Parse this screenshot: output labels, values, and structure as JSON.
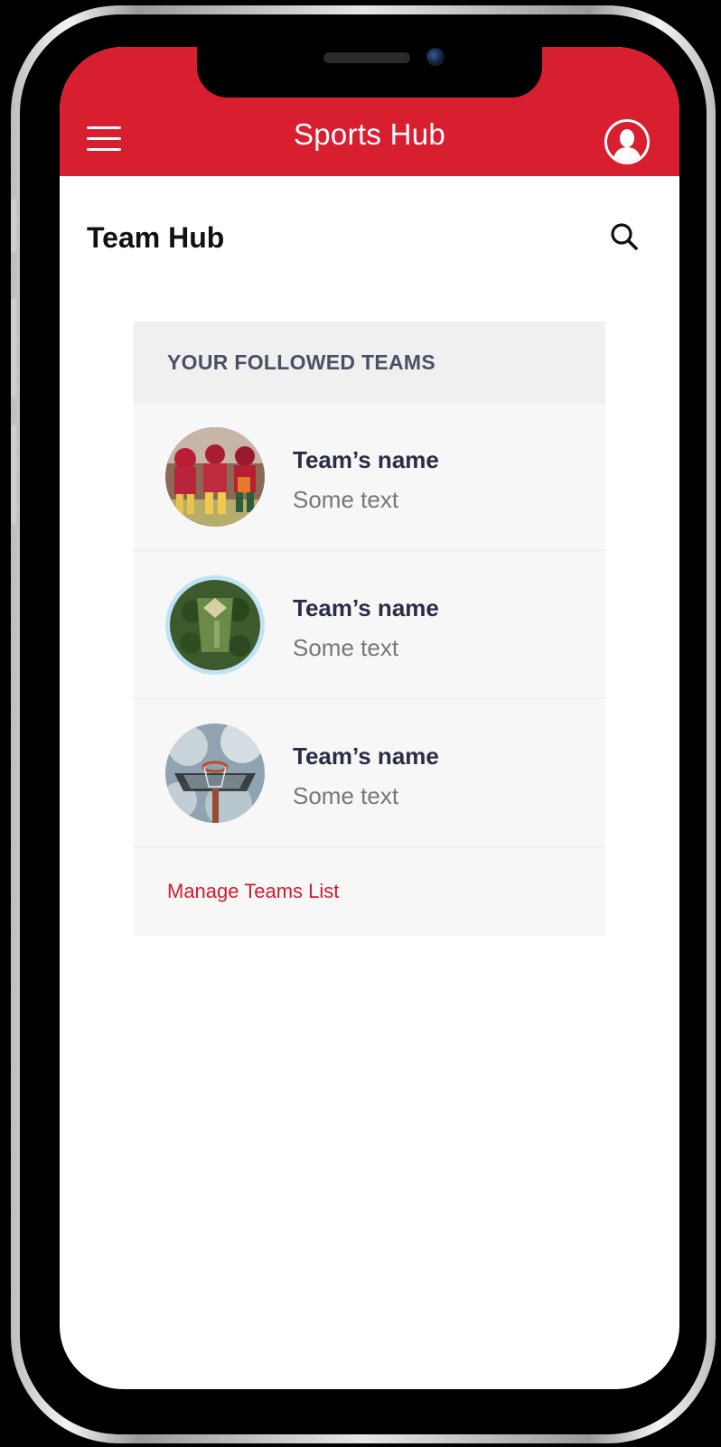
{
  "header": {
    "title": "Sports Hub",
    "menu_icon": "hamburger-menu-icon",
    "profile_icon": "user-avatar-icon"
  },
  "page": {
    "title": "Team Hub",
    "search_icon": "search-icon"
  },
  "followed_teams": {
    "heading": "YOUR FOLLOWED TEAMS",
    "teams": [
      {
        "name": "Team’s name",
        "subtitle": "Some text",
        "image": "football-players-photo"
      },
      {
        "name": "Team’s name",
        "subtitle": "Some text",
        "image": "baseball-field-aerial-photo"
      },
      {
        "name": "Team’s name",
        "subtitle": "Some text",
        "image": "basketball-hoop-photo"
      }
    ],
    "manage_link": "Manage Teams List"
  },
  "colors": {
    "brand_red": "#d81f30",
    "link_red": "#cc1f2f",
    "card_bg": "#f7f7f7",
    "card_header_bg": "#f0f0f1",
    "team_name": "#2b2d44",
    "subtitle": "#777777"
  }
}
